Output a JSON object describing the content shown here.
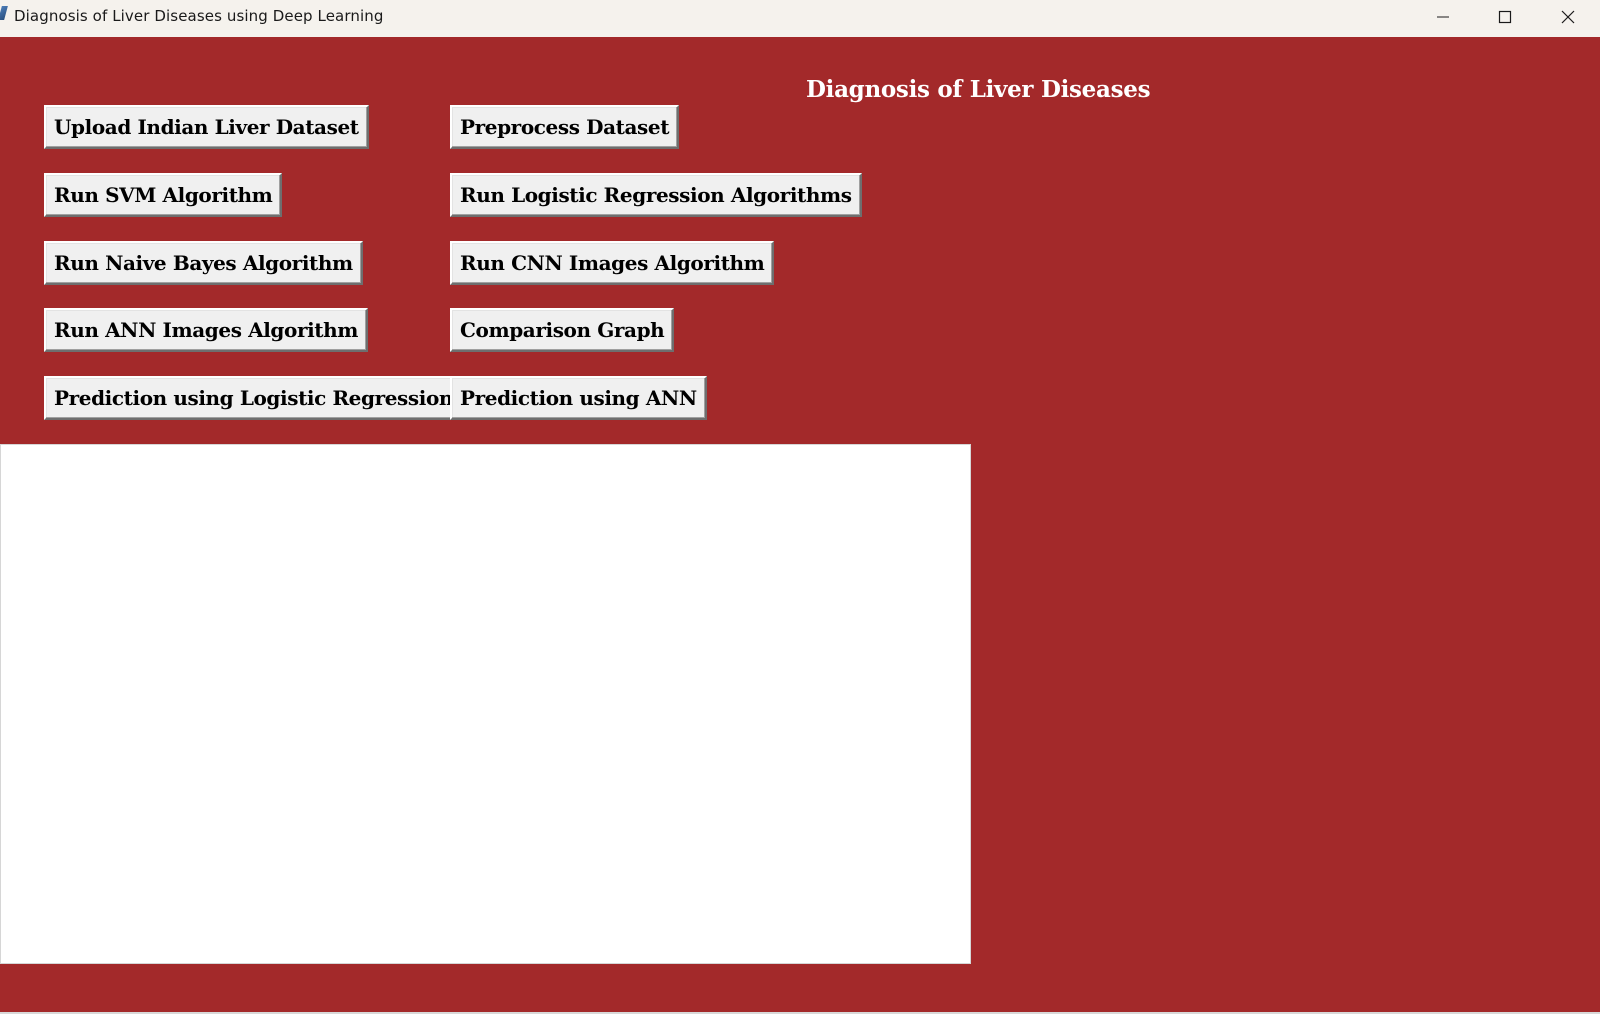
{
  "window": {
    "title": "Diagnosis of Liver Diseases using Deep Learning",
    "controls": {
      "minimize_icon": "minimize-icon",
      "maximize_icon": "maximize-icon",
      "close_icon": "close-icon"
    }
  },
  "colors": {
    "client_background": "#a3292a",
    "titlebar_background": "#f5f2ed",
    "heading_text": "#ffffff",
    "button_face": "#f0f0f0",
    "output_background": "#ffffff"
  },
  "main": {
    "heading": "Diagnosis of Liver Diseases",
    "buttons": {
      "upload_dataset": "Upload Indian Liver Dataset",
      "preprocess_dataset": "Preprocess Dataset",
      "run_svm": "Run SVM Algorithm",
      "run_logistic_regression": "Run Logistic Regression Algorithms",
      "run_naive_bayes": "Run Naive Bayes Algorithm",
      "run_cnn": "Run CNN Images Algorithm",
      "run_ann": "Run ANN Images Algorithm",
      "comparison_graph": "Comparison Graph",
      "predict_logistic_regression": "Prediction using Logistic Regression",
      "predict_ann": "Prediction using ANN"
    },
    "output": {
      "text": ""
    }
  }
}
